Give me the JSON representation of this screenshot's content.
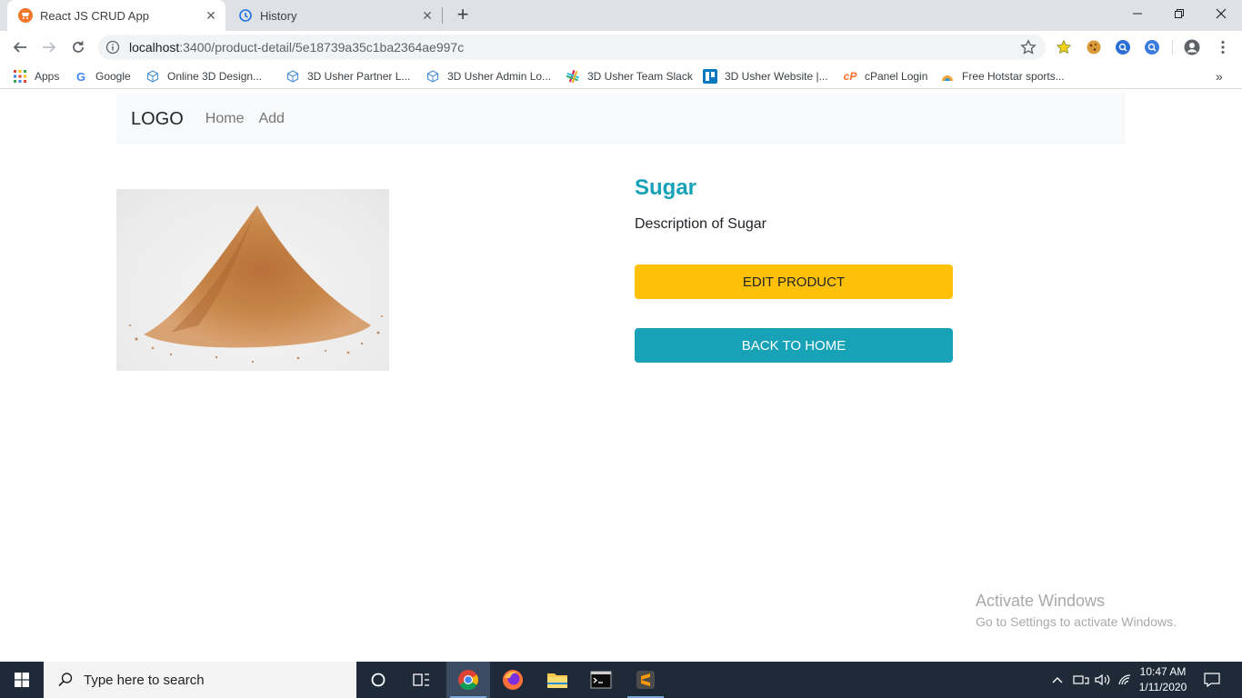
{
  "browser": {
    "tabs": [
      {
        "title": "React JS CRUD App",
        "active": true
      },
      {
        "title": "History",
        "active": false
      }
    ],
    "url": {
      "host": "localhost",
      "path": ":3400/product-detail/5e18739a35c1ba2364ae997c"
    },
    "bookmarks": [
      {
        "label": "Apps",
        "icon": "apps-grid-icon"
      },
      {
        "label": "Google",
        "icon": "google-icon"
      },
      {
        "label": "Online 3D Design...",
        "icon": "cube-icon"
      },
      {
        "label": "3D Usher Partner L...",
        "icon": "cube-icon"
      },
      {
        "label": "3D Usher Admin Lo...",
        "icon": "cube-icon"
      },
      {
        "label": "3D Usher Team Slack",
        "icon": "slack-icon"
      },
      {
        "label": "3D Usher Website |...",
        "icon": "trello-icon"
      },
      {
        "label": "cPanel Login",
        "icon": "cpanel-icon"
      },
      {
        "label": "Free Hotstar sports...",
        "icon": "hotstar-icon"
      }
    ]
  },
  "page": {
    "brand": "LOGO",
    "nav": [
      {
        "label": "Home"
      },
      {
        "label": "Add"
      }
    ],
    "product": {
      "title": "Sugar",
      "description": "Description of Sugar",
      "edit_label": "EDIT PRODUCT",
      "home_label": "BACK TO HOME"
    },
    "watermark": {
      "line1": "Activate Windows",
      "line2": "Go to Settings to activate Windows."
    }
  },
  "taskbar": {
    "search_placeholder": "Type here to search",
    "time": "10:47 AM",
    "date": "1/11/2020"
  },
  "colors": {
    "accent_info": "#17a2b8",
    "accent_warning": "#ffc107",
    "navbar_bg": "#f8f9fa",
    "taskbar_bg": "#1f2a38"
  }
}
